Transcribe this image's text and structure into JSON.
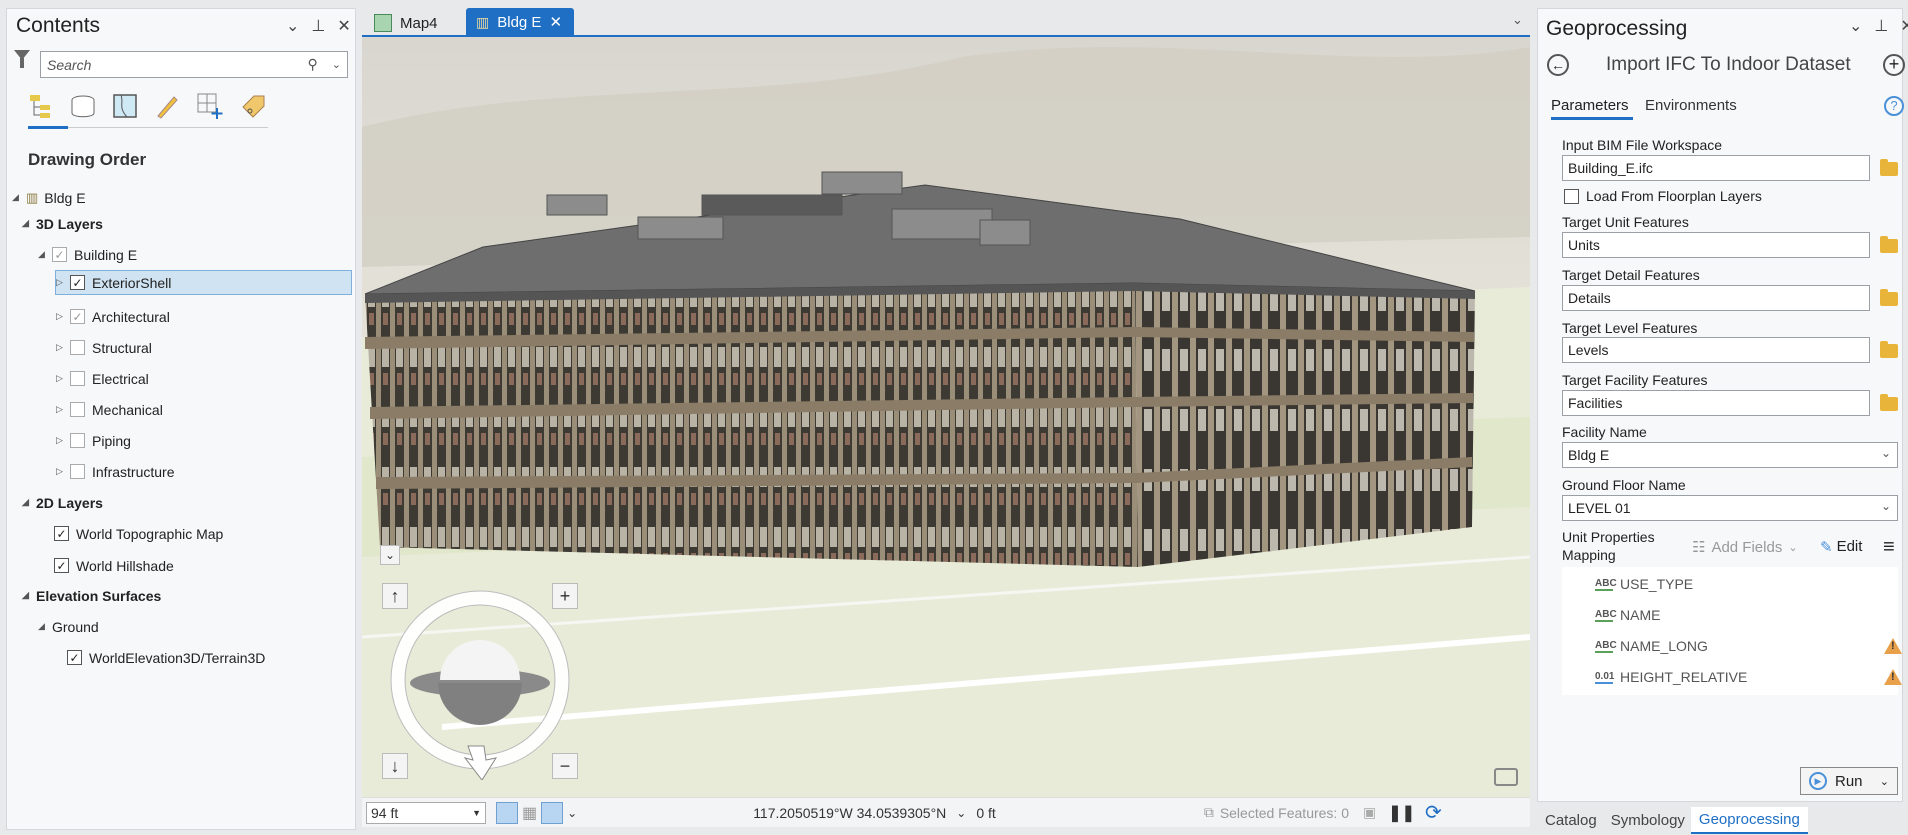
{
  "contents": {
    "title": "Contents",
    "search_placeholder": "Search",
    "toolbar_icons": [
      "list-by-drawing-order-icon",
      "list-by-source-icon",
      "list-by-selection-icon",
      "list-by-editing-icon",
      "list-by-snapping-icon",
      "list-by-labeling-icon"
    ],
    "section_heading": "Drawing Order",
    "tree": {
      "scene": "Bldg E",
      "layers3d": "3D Layers",
      "building": "Building E",
      "sublayers": [
        {
          "label": "ExteriorShell",
          "checked": true,
          "selected": true
        },
        {
          "label": "Architectural",
          "checked": true
        },
        {
          "label": "Structural",
          "checked": false
        },
        {
          "label": "Electrical",
          "checked": false
        },
        {
          "label": "Mechanical",
          "checked": false
        },
        {
          "label": "Piping",
          "checked": false
        },
        {
          "label": "Infrastructure",
          "checked": false
        }
      ],
      "layers2d": "2D Layers",
      "layers2d_items": [
        {
          "label": "World Topographic Map",
          "checked": true
        },
        {
          "label": "World Hillshade",
          "checked": true
        }
      ],
      "elevation": "Elevation Surfaces",
      "ground": "Ground",
      "terrain": "WorldElevation3D/Terrain3D"
    }
  },
  "tabs": [
    {
      "label": "Map4",
      "active": false
    },
    {
      "label": "Bldg E",
      "active": true
    }
  ],
  "map": {
    "nav_up": "↑",
    "nav_down": "↓",
    "zoom_in": "+",
    "zoom_out": "−"
  },
  "status": {
    "scale": "94 ft",
    "coordinates": "117.2050519°W 34.0539305°N",
    "elevation": "0 ft",
    "selected_features": "Selected Features: 0"
  },
  "geoprocessing": {
    "title": "Geoprocessing",
    "tool_title": "Import IFC To Indoor Dataset",
    "tabs": [
      "Parameters",
      "Environments"
    ],
    "params": {
      "input_bim_label": "Input BIM File Workspace",
      "input_bim_value": "Building_E.ifc",
      "load_floorplan_label": "Load From Floorplan Layers",
      "unit_label": "Target Unit Features",
      "unit_value": "Units",
      "detail_label": "Target Detail Features",
      "detail_value": "Details",
      "level_label": "Target Level Features",
      "level_value": "Levels",
      "facility_label": "Target Facility Features",
      "facility_value": "Facilities",
      "facility_name_label": "Facility Name",
      "facility_name_value": "Bldg E",
      "ground_floor_label": "Ground Floor Name",
      "ground_floor_value": "LEVEL 01",
      "mapping_label_1": "Unit Properties",
      "mapping_label_2": "Mapping",
      "add_fields": "Add Fields",
      "edit": "Edit"
    },
    "fields": [
      {
        "type": "ABC",
        "name": "USE_TYPE",
        "warning": false
      },
      {
        "type": "ABC",
        "name": "NAME",
        "warning": false
      },
      {
        "type": "ABC",
        "name": "NAME_LONG",
        "warning": true
      },
      {
        "type": "0.01",
        "name": "HEIGHT_RELATIVE",
        "warning": true
      }
    ],
    "run": "Run",
    "bottom_tabs": [
      "Catalog",
      "Symbology",
      "Geoprocessing"
    ]
  },
  "colors": {
    "accent": "#1f6fc5",
    "selected_row": "#cfe3f3",
    "warning": "#e8a04a"
  }
}
